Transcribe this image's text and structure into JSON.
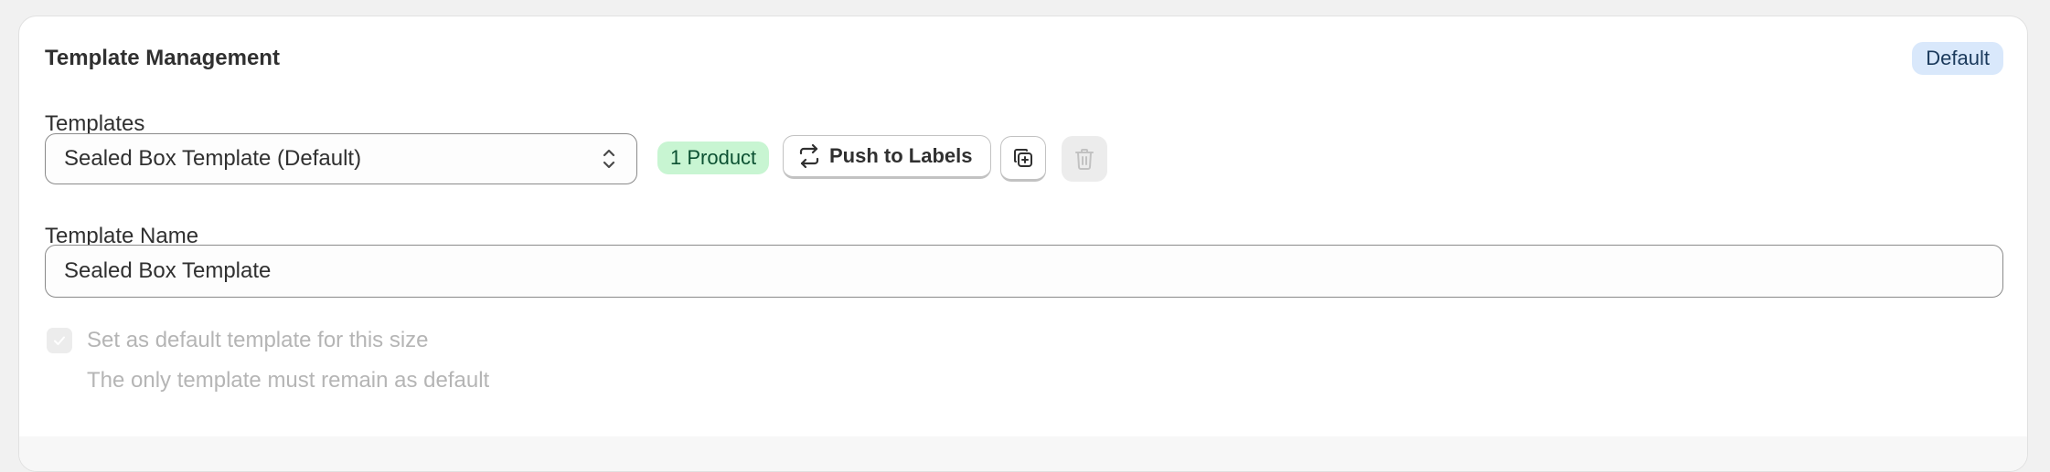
{
  "card": {
    "title": "Template Management",
    "status_badge": "Default"
  },
  "templates": {
    "label": "Templates",
    "selected": "Sealed Box Template (Default)",
    "product_badge": "1 Product",
    "push_button_label": "Push to Labels",
    "duplicate_icon": "duplicate-icon",
    "delete_icon": "trash-icon"
  },
  "template_name": {
    "label": "Template Name",
    "value": "Sealed Box Template"
  },
  "default_checkbox": {
    "label": "Set as default template for this size",
    "checked": true,
    "disabled": true,
    "help_text": "The only template must remain as default"
  },
  "colors": {
    "default_badge_bg": "#d9e8fb",
    "product_badge_bg": "#c8f5d2",
    "disabled_text": "#b5b5b5"
  }
}
